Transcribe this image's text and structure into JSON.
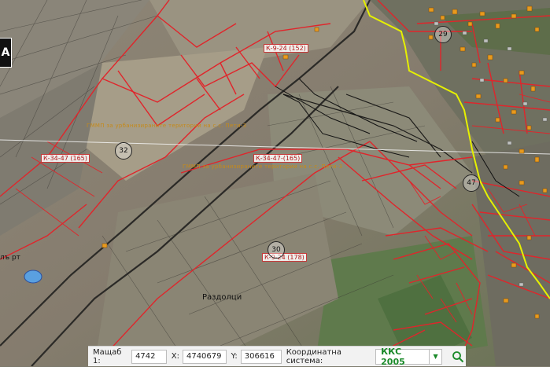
{
  "map": {
    "logo_glyph": "A",
    "labels": {
      "k_24": "К-9-24 (152)",
      "k_34_left": "К-34-47 (165)",
      "k_34_mid": "К-34-47-(165)",
      "k_9_178": "К-9-24 (178)",
      "gmmp_1": "ГММП за урбанизираните територии на с.с. Пети-3",
      "gmmp_2": "ГММП за урбанизираните територии на с.с. Пети-3",
      "place": "Раздолци",
      "edge": "лъ рт"
    },
    "circles": {
      "c32": "32",
      "c30": "30",
      "c47": "47",
      "c29": "29"
    }
  },
  "status": {
    "scale_label": "Мащаб 1:",
    "scale_value": "4742",
    "x_label": "X:",
    "x_value": "4740679",
    "y_label": "Y:",
    "y_value": "306616",
    "crs_label": "Координатна система:",
    "crs_value": "ККС 2005",
    "dropdown_glyph": "▼"
  },
  "colors": {
    "parcel_red": "#e0252b",
    "boundary_yellow": "#e6f000",
    "crs_green": "#1b8a2a",
    "building_orange": "#e89a1e"
  }
}
